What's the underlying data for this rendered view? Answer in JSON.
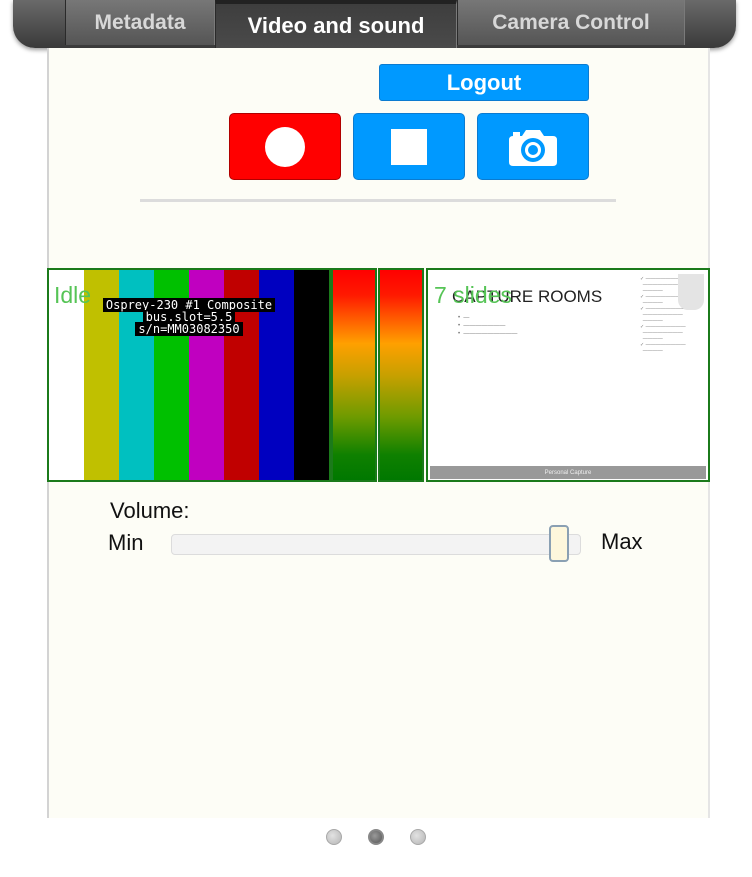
{
  "tabs": [
    {
      "label": "Metadata",
      "active": false
    },
    {
      "label": "Video and sound",
      "active": true
    },
    {
      "label": "Camera Control",
      "active": false
    }
  ],
  "actions": {
    "logout_label": "Logout",
    "record_icon": "record-icon",
    "stop_icon": "stop-icon",
    "snapshot_icon": "camera-icon",
    "record_color": "#ff0000",
    "accent": "#0099ff"
  },
  "video": {
    "status": "Idle",
    "caption_line1": "Osprey-230 #1  Composite",
    "caption_line2": "bus.slot=5.5",
    "caption_line3": "s/n=MM03082350",
    "color_bars": [
      "#ffffff",
      "#c0c000",
      "#00c0c0",
      "#00c000",
      "#c000c0",
      "#c00000",
      "#0000c0",
      "#000000"
    ]
  },
  "slides": {
    "count_label": "7 slides",
    "slide_title": "CAPTURE ROOMS",
    "footer": "Personal Capture"
  },
  "volume": {
    "label": "Volume:",
    "min_label": "Min",
    "max_label": "Max",
    "level_fraction": 0.97
  },
  "pager": {
    "page_count": 3,
    "active_index": 1
  },
  "colors": {
    "status_green": "#56c456",
    "frame_green": "#1b7a1b",
    "panel_bg": "#fdfdf6"
  }
}
